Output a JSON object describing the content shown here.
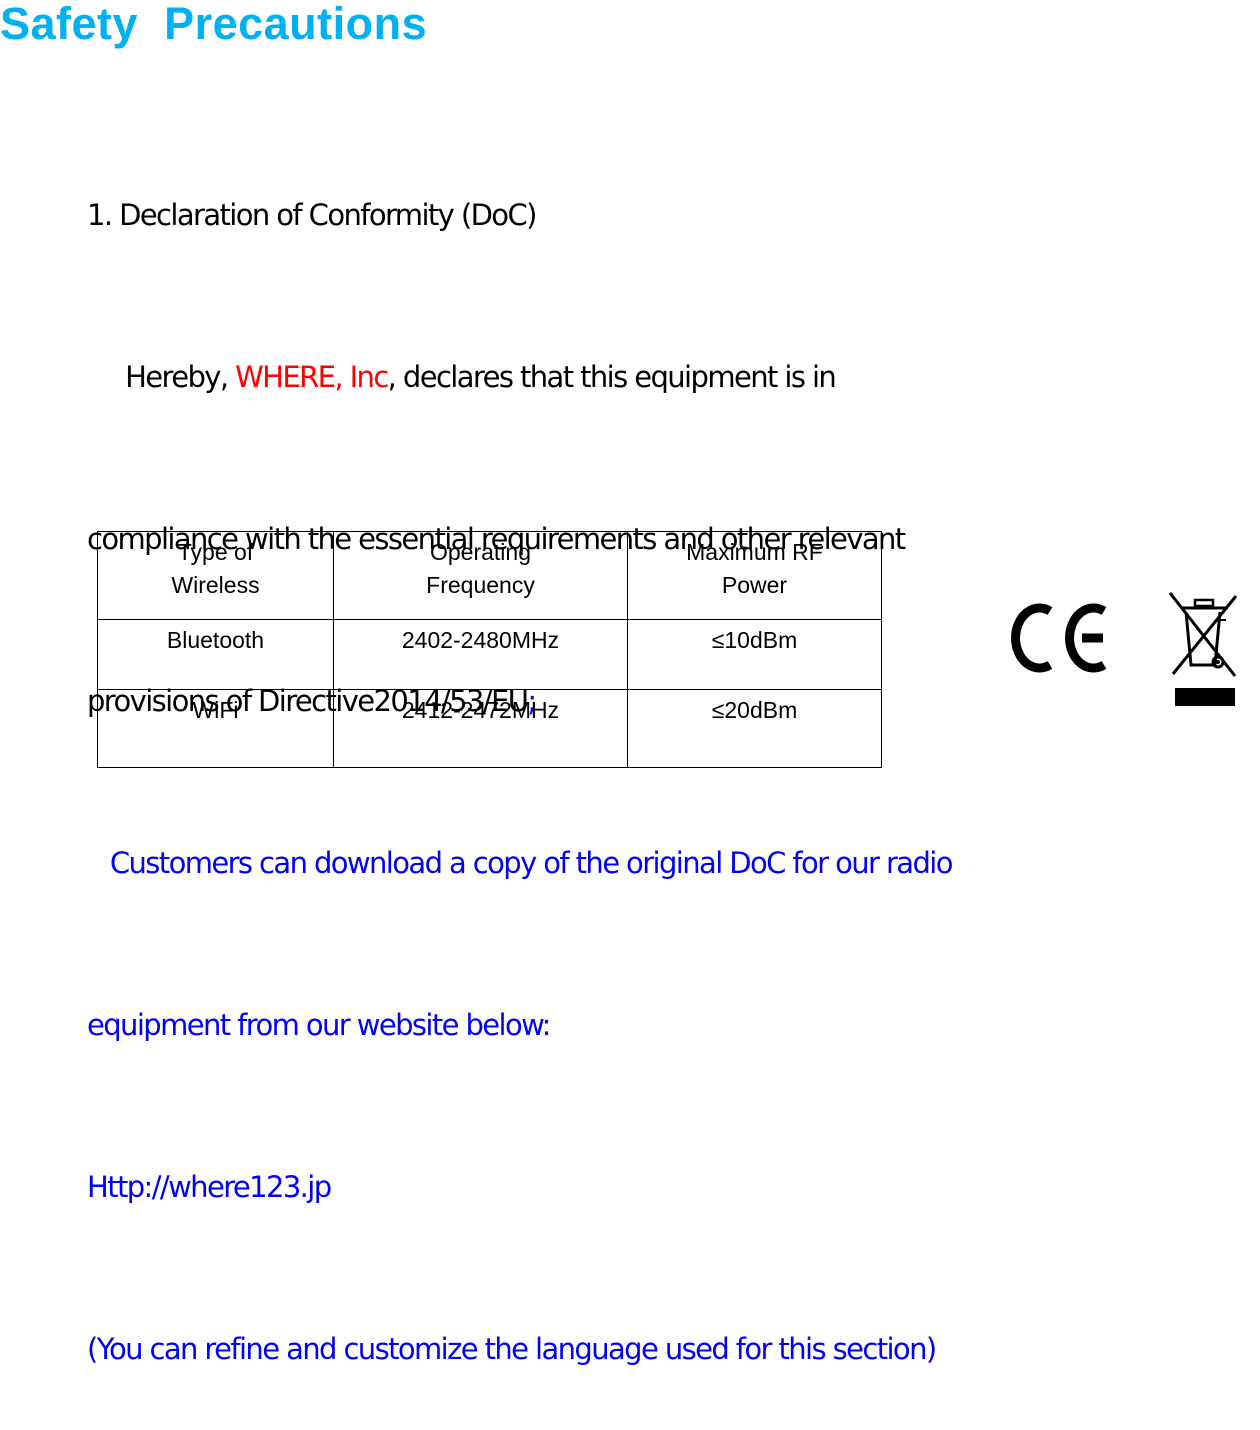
{
  "title": "Safety  Precautions",
  "section": {
    "heading": "1. Declaration of Conformity (DoC)",
    "hereby_prefix": "     Hereby, ",
    "company": "WHERE, Inc",
    "hereby_suffix": ", declares that this equipment is in",
    "line3": "compliance with the essential requirements and other relevant",
    "line4_text": "provisions of Directive2014/53/EU",
    "line4_punct": ";",
    "download_line1": "   Customers can download a copy of the original DoC for our radio",
    "download_line2": "equipment from our website below:",
    "website": "Http://where123.jp",
    "note": "(You can refine and customize the language used for this section)"
  },
  "table": {
    "headers": [
      [
        "Type of",
        "Wireless"
      ],
      [
        "Operating",
        "Frequency"
      ],
      [
        "Maximum RF",
        "Power"
      ]
    ],
    "rows": [
      [
        "Bluetooth",
        "2402-2480MHz",
        "≤10dBm"
      ],
      [
        "WiFi",
        "2412-2472MHz",
        "≤20dBm"
      ]
    ]
  },
  "marks": {
    "icons": [
      "ce-mark-icon",
      "weee-crossed-bin-icon"
    ]
  },
  "colors": {
    "title": "#00b0f0",
    "company": "#ff0000",
    "link_text": "#0000ff"
  }
}
